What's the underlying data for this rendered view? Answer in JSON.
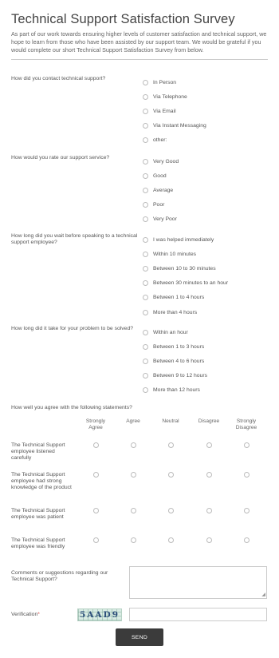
{
  "form": {
    "title": "Technical Support Satisfaction Survey",
    "intro": "As part of our work towards ensuring higher levels of customer satisfaction and technical support, we hope to learn from those who have been assisted by our support team. We would be grateful if you would complete our short Technical Support Satisfaction Survey from below."
  },
  "questions": [
    {
      "label": "How did you contact technical support?",
      "options": [
        "In Person",
        "Via Telephone",
        "Via Email",
        "Via Instant Messaging",
        "other:"
      ]
    },
    {
      "label": "How would you rate our support service?",
      "options": [
        "Very Good",
        "Good",
        "Average",
        "Poor",
        "Very Poor"
      ]
    },
    {
      "label": "How long did you wait before speaking to a technical support employee?",
      "options": [
        "I was helped immediately",
        "Within 10 minutes",
        "Between 10 to 30 minutes",
        "Between 30 minutes to an hour",
        "Between 1 to 4 hours",
        "More than 4 hours"
      ]
    },
    {
      "label": "How long did it take for your problem to be solved?",
      "options": [
        "Within an hour",
        "Between 1 to 3 hours",
        "Between 4 to 6 hours",
        "Between 9 to 12 hours",
        "More than 12 hours"
      ]
    }
  ],
  "matrix": {
    "title": "How well you agree with the following statements?",
    "columns": [
      "Strongly Agree",
      "Agree",
      "Neutral",
      "Disagree",
      "Strongly Disagree"
    ],
    "rows": [
      "The Technical Support employee listened carefully",
      "The Technical Support employee had strong knowledge of the product",
      "The Technical Support employee was patient",
      "The Technical Support employee was friendly"
    ]
  },
  "comments": {
    "label": "Comments or suggestions regarding our Technical Support?",
    "value": ""
  },
  "verification": {
    "label": "Verification",
    "required_mark": "*",
    "captcha_text": "5AAD9",
    "value": ""
  },
  "submit": {
    "label": "SEND"
  },
  "colors": {
    "button_bg": "#3b3b3b",
    "required": "#d9534f",
    "captcha_bg": "#d9ece4"
  }
}
